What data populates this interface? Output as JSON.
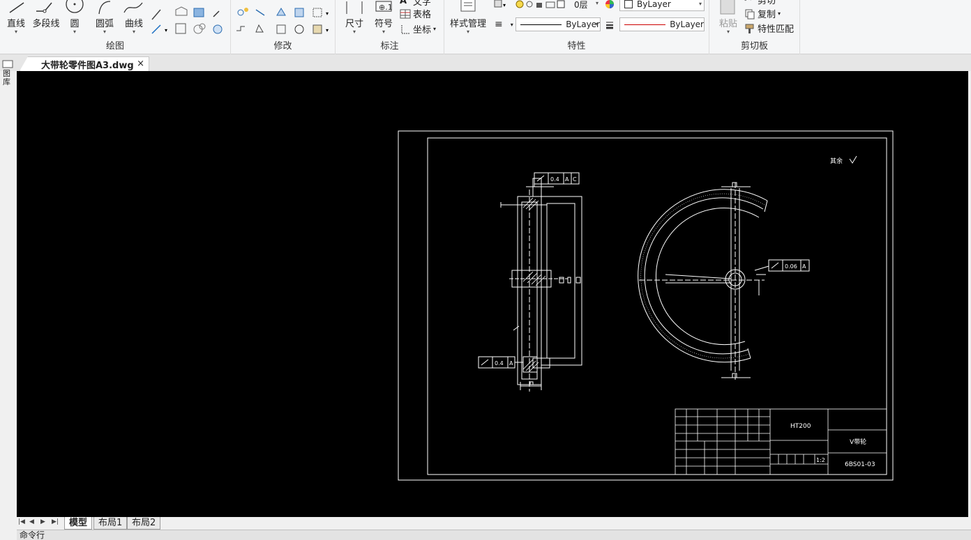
{
  "ribbon": {
    "draw": {
      "title": "绘图",
      "line": "直线",
      "polyline": "多段线",
      "circle": "圆",
      "arc": "圆弧",
      "curve": "曲线"
    },
    "modify": {
      "title": "修改"
    },
    "annotate": {
      "title": "标注",
      "dimension": "尺寸",
      "symbol": "符号",
      "text": "文字",
      "table": "表格",
      "coordinate": "坐标"
    },
    "properties": {
      "title": "特性",
      "style_manager": "样式管理",
      "layer_value": "0层",
      "color_value": "ByLayer",
      "linetype_value": "ByLayer",
      "lineweight_value": "ByLayer"
    },
    "clipboard": {
      "title": "剪切板",
      "paste": "粘贴",
      "cut": "剪切",
      "copy": "复制",
      "match_props": "特性匹配"
    }
  },
  "side_strip": {
    "label": "图库"
  },
  "document_tab": {
    "title": "大带轮零件图A3.dwg",
    "close": "×"
  },
  "drawing": {
    "roughness_note": "其余",
    "tol_left_top": {
      "value": "0.4",
      "datum1": "A",
      "datum2": "C"
    },
    "tol_left_bottom": {
      "value": "0.4",
      "datum": "A"
    },
    "tol_right": {
      "value": "0.06",
      "datum": "A"
    },
    "title_block": {
      "material": "HT200",
      "part_name": "V带轮",
      "drawing_no": "6BS01-03",
      "scale": "1:2"
    }
  },
  "layout_tabs": {
    "model": "模型",
    "layout1": "布局1",
    "layout2": "布局2"
  },
  "command_line": {
    "label": "命令行"
  }
}
